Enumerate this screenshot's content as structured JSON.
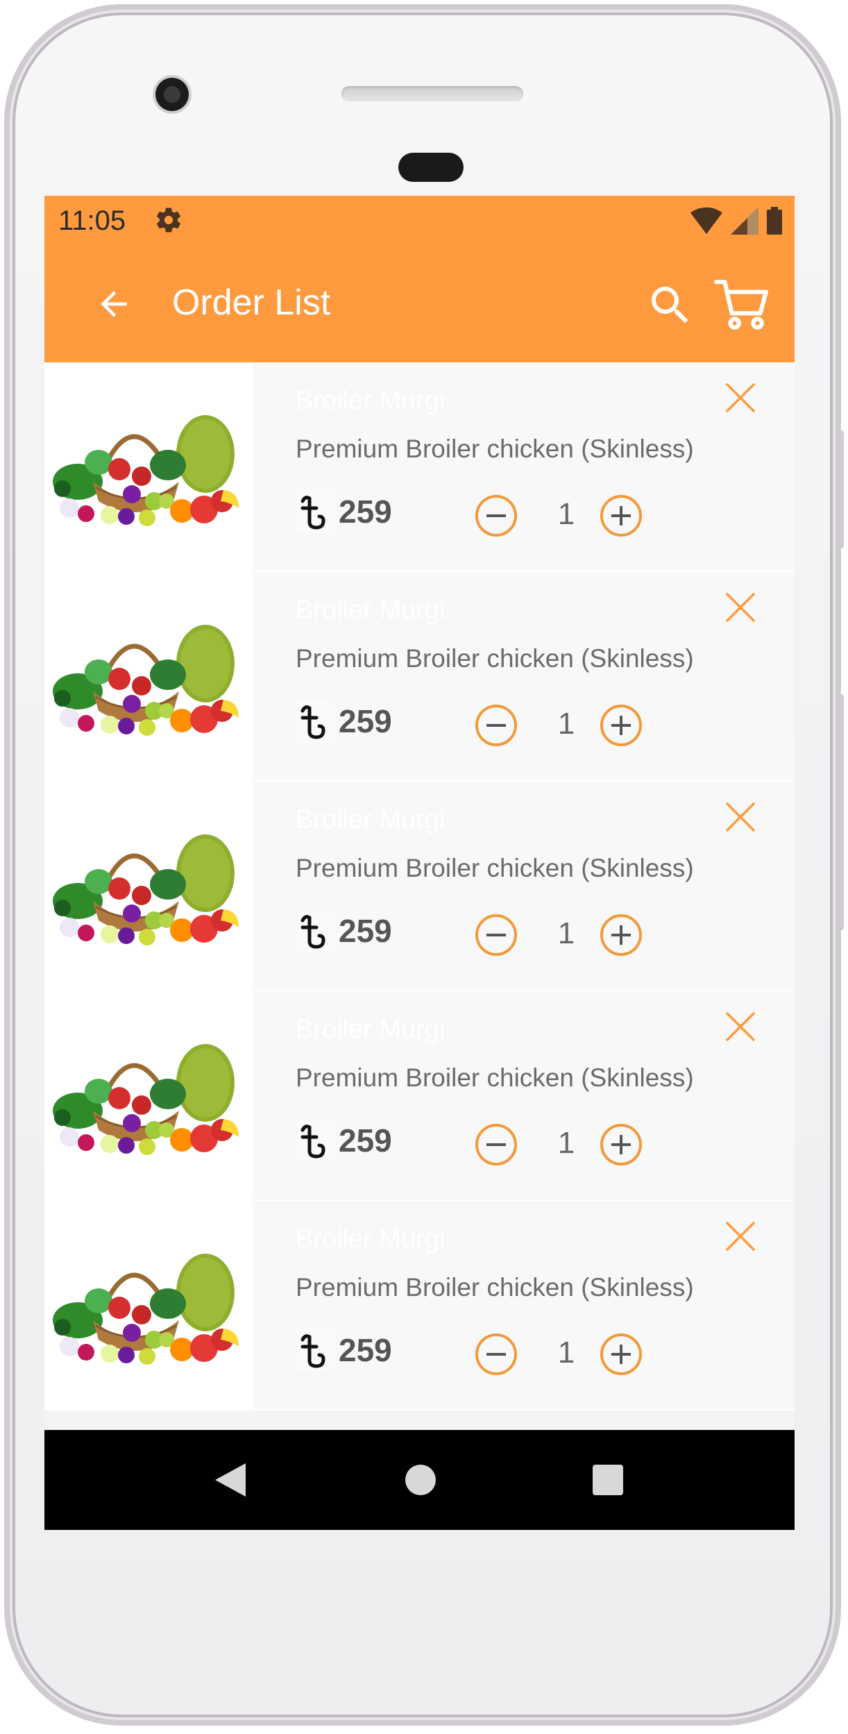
{
  "status_bar": {
    "time": "11:05"
  },
  "app_bar": {
    "title": "Order List"
  },
  "colors": {
    "accent": "#ff9a3e",
    "text_gray": "#6b6b6b",
    "price_gray": "#555555"
  },
  "icons": {
    "status": [
      "gear-icon",
      "wifi-icon",
      "signal-icon",
      "battery-icon"
    ],
    "app_bar": [
      "back-arrow-icon",
      "search-icon",
      "cart-icon"
    ],
    "row": [
      "product-image",
      "taka-icon",
      "minus-circle-icon",
      "plus-circle-icon",
      "close-icon"
    ],
    "nav": [
      "nav-back-icon",
      "nav-home-icon",
      "nav-recents-icon"
    ]
  },
  "order_items": [
    {
      "brand": "Broiler Murgi",
      "name": "Premium Broiler chicken (Skinless)",
      "price": "259",
      "quantity": "1"
    },
    {
      "brand": "Broiler Murgi",
      "name": "Premium Broiler chicken (Skinless)",
      "price": "259",
      "quantity": "1"
    },
    {
      "brand": "Broiler Murgi",
      "name": "Premium Broiler chicken (Skinless)",
      "price": "259",
      "quantity": "1"
    },
    {
      "brand": "Broiler Murgi",
      "name": "Premium Broiler chicken (Skinless)",
      "price": "259",
      "quantity": "1"
    },
    {
      "brand": "Broiler Murgi",
      "name": "Premium Broiler chicken (Skinless)",
      "price": "259",
      "quantity": "1"
    }
  ]
}
